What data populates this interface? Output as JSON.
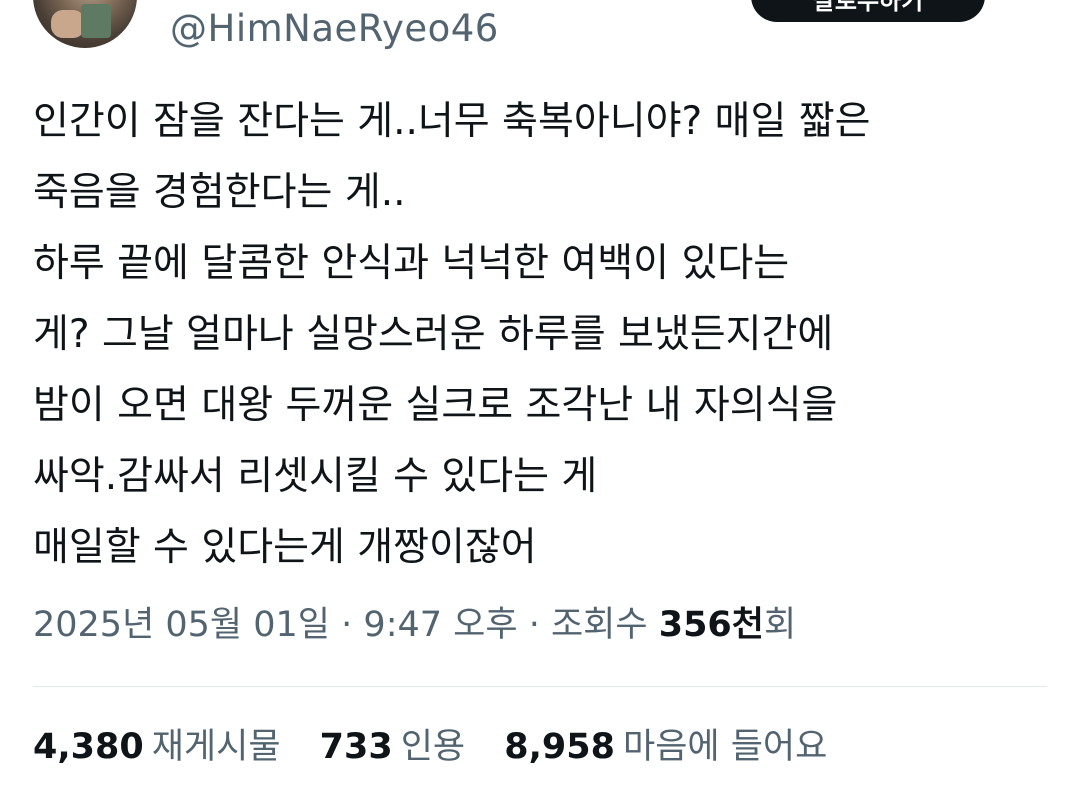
{
  "header": {
    "handle": "@HimNaeRyeo46",
    "follow_label": "팔로우하기"
  },
  "tweet": {
    "lines": [
      "인간이 잠을 잔다는 게..너무 축복아니야? 매일 짧은",
      "죽음을 경험한다는 게..",
      "하루 끝에 달콤한 안식과 넉넉한 여백이 있다는",
      "게? 그날 얼마나 실망스러운 하루를 보냈든지간에",
      "밤이 오면 대왕 두꺼운 실크로 조각난 내 자의식을",
      "싸악.감싸서 리셋시킬 수 있다는 게",
      "매일할 수 있다는게 개짱이잖어"
    ]
  },
  "meta": {
    "date": "2025년 05월 01일",
    "separator": "·",
    "time": "9:47 오후",
    "views_label": "조회수",
    "views_count": "356천",
    "views_suffix": "회"
  },
  "stats": [
    {
      "value": "4,380",
      "label": "재게시물"
    },
    {
      "value": "733",
      "label": "인용"
    },
    {
      "value": "8,958",
      "label": "마음에 들어요"
    }
  ],
  "colors": {
    "text": "#0f1419",
    "secondary": "#536471",
    "divider": "#e6e9ec",
    "button_bg": "#0f1419"
  },
  "icons": {
    "more": "more-horizontal-icon"
  }
}
